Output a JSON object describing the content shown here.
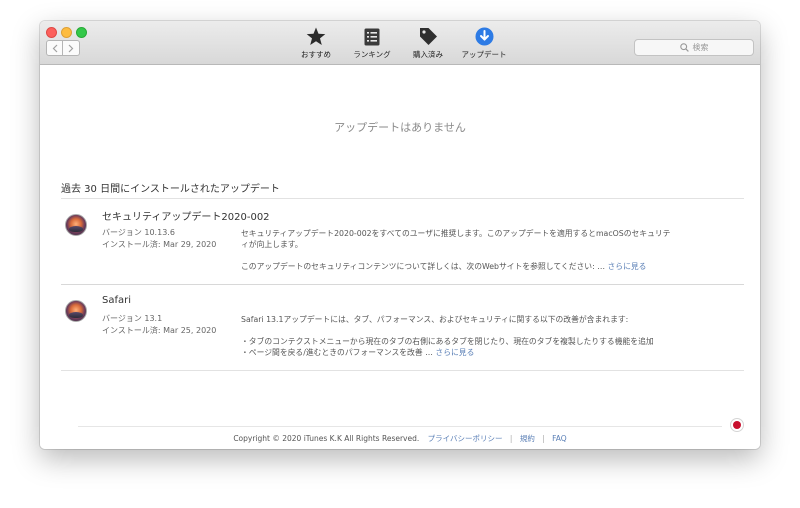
{
  "toolbar": {
    "tabs": [
      {
        "label": "おすすめ",
        "icon": "star-icon"
      },
      {
        "label": "ランキング",
        "icon": "list-icon"
      },
      {
        "label": "購入済み",
        "icon": "tag-icon"
      },
      {
        "label": "アップデート",
        "icon": "download-icon"
      }
    ],
    "search": {
      "placeholder": "検索"
    },
    "accent_color": "#2d7be5"
  },
  "main": {
    "no_updates": "アップデートはありません",
    "section_title": "過去 30 日間にインストールされたアップデート",
    "updates": [
      {
        "name": "セキュリティアップデート2020-002",
        "version": "バージョン 10.13.6",
        "installed": "インストール済: Mar 29, 2020",
        "desc_line1": "セキュリティアップデート2020-002をすべてのユーザに推奨します。このアップデートを適用するとmacOSのセキュリテ",
        "desc_line2": "ィが向上します。",
        "desc_line3": "このアップデートのセキュリティコンテンツについて詳しくは、次のWebサイトを参照してください: …",
        "more": "さらに見る"
      },
      {
        "name": "Safari",
        "version": "バージョン 13.1",
        "installed": "インストール済: Mar 25, 2020",
        "desc_line1": "Safari 13.1アップデートには、タブ、パフォーマンス、およびセキュリティに関する以下の改善が含まれます:",
        "desc_line2": "・タブのコンテクストメニューから現在のタブの右側にあるタブを閉じたり、現在のタブを複製したりする機能を追加",
        "desc_line3": "・ページ間を戻る/進むときのパフォーマンスを改善 …",
        "more": "さらに見る"
      }
    ]
  },
  "footer": {
    "copyright": "Copyright © 2020 iTunes K.K All Rights Reserved.",
    "privacy": "プライバシーポリシー",
    "terms": "規約",
    "faq": "FAQ",
    "separator": "|"
  }
}
